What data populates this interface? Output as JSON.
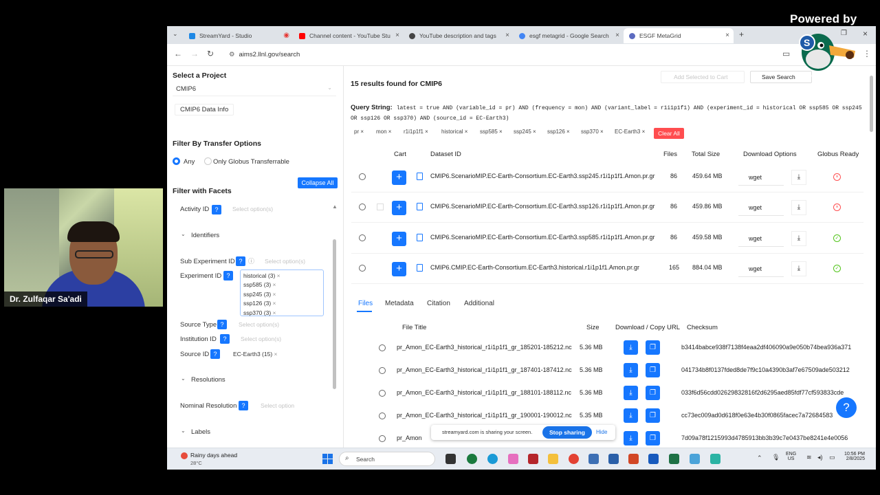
{
  "overlay": {
    "powered_by": "Powered by",
    "watermark": "StreamYard",
    "presenter_name": "Dr. Zulfaqar Sa'adi"
  },
  "browser": {
    "tabs": [
      {
        "label": "StreamYard - Studio",
        "color": "#1e88e5"
      },
      {
        "label": "Channel content - YouTube Stu",
        "color": "#ff0000"
      },
      {
        "label": "YouTube description and tags",
        "color": "#444444"
      },
      {
        "label": "esgf metagrid - Google Search",
        "color": "#4285f4"
      },
      {
        "label": "ESGF MetaGrid",
        "color": "#5c6bc0"
      }
    ],
    "url": "aims2.llnl.gov/search"
  },
  "left": {
    "select_project_title": "Select a Project",
    "project_value": "CMIP6",
    "data_info": "CMIP6 Data Info",
    "transfer_title": "Filter By Transfer Options",
    "radio_any": "Any",
    "radio_globus": "Only Globus Transferrable",
    "facets_title": "Filter with Facets",
    "collapse_all": "Collapse All",
    "activity_id": "Activity ID",
    "select_placeholder": "Select option(s)",
    "select_option": "Select option",
    "identifiers": "Identifiers",
    "sub_experiment_id": "Sub Experiment ID",
    "experiment_id": "Experiment ID",
    "experiment_chips": [
      "historical (3)",
      "ssp585 (3)",
      "ssp245 (3)",
      "ssp126 (3)",
      "ssp370 (3)"
    ],
    "source_type": "Source Type",
    "institution_id": "Institution ID",
    "source_id": "Source ID",
    "source_chip": "EC-Earth3 (15)",
    "resolutions": "Resolutions",
    "nominal_resolution": "Nominal Resolution",
    "labels": "Labels"
  },
  "right": {
    "add_selected": "Add Selected to Cart",
    "save_search": "Save Search",
    "results": "15 results found for CMIP6",
    "query_label": "Query String:",
    "query_text": "latest = true AND (variable_id = pr) AND (frequency = mon) AND (variant_label = r1i1p1f1) AND (experiment_id = historical OR ssp585 OR ssp245 OR ssp126 OR ssp370) AND (source_id = EC-Earth3)",
    "filter_chips": [
      "pr",
      "mon",
      "r1i1p1f1",
      "historical",
      "ssp585",
      "ssp245",
      "ssp126",
      "ssp370",
      "EC-Earth3"
    ],
    "clear_all": "Clear All",
    "columns": {
      "cart": "Cart",
      "dataset_id": "Dataset ID",
      "files": "Files",
      "total_size": "Total Size",
      "download": "Download Options",
      "globus": "Globus Ready"
    },
    "datasets": [
      {
        "id": "CMIP6.ScenarioMIP.EC-Earth-Consortium.EC-Earth3.ssp245.r1i1p1f1.Amon.pr.gr",
        "files": "86",
        "size": "459.64 MB",
        "dl": "wget",
        "globus": "no"
      },
      {
        "id": "CMIP6.ScenarioMIP.EC-Earth-Consortium.EC-Earth3.ssp126.r1i1p1f1.Amon.pr.gr",
        "files": "86",
        "size": "459.86 MB",
        "dl": "wget",
        "globus": "no"
      },
      {
        "id": "CMIP6.ScenarioMIP.EC-Earth-Consortium.EC-Earth3.ssp585.r1i1p1f1.Amon.pr.gr",
        "files": "86",
        "size": "459.58 MB",
        "dl": "wget",
        "globus": "yes"
      },
      {
        "id": "CMIP6.CMIP.EC-Earth-Consortium.EC-Earth3.historical.r1i1p1f1.Amon.pr.gr",
        "files": "165",
        "size": "884.04 MB",
        "dl": "wget",
        "globus": "yes"
      }
    ],
    "detail_tabs": [
      "Files",
      "Metadata",
      "Citation",
      "Additional"
    ],
    "file_columns": {
      "title": "File Title",
      "size": "Size",
      "download": "Download / Copy URL",
      "checksum": "Checksum"
    },
    "files": [
      {
        "title": "pr_Amon_EC-Earth3_historical_r1i1p1f1_gr_185201-185212.nc",
        "size": "5.36 MB",
        "checksum": "b3414babce938f7138f4eaa2df406090a9e050b74bea936a371"
      },
      {
        "title": "pr_Amon_EC-Earth3_historical_r1i1p1f1_gr_187401-187412.nc",
        "size": "5.36 MB",
        "checksum": "041734b8f0137fded8de7f9c10a4390b3af7e67509ade503212"
      },
      {
        "title": "pr_Amon_EC-Earth3_historical_r1i1p1f1_gr_188101-188112.nc",
        "size": "5.36 MB",
        "checksum": "033f6d56cdd02629832816f2d6295aed85fdf77cf593833cde"
      },
      {
        "title": "pr_Amon_EC-Earth3_historical_r1i1p1f1_gr_190001-190012.nc",
        "size": "5.35 MB",
        "checksum": "cc73ec009ad0d618f0e63e4b30f0865facec7a72684583"
      },
      {
        "title": "pr_Amon",
        "size": "",
        "checksum": "7d09a78f1215993d4785913bb3b39c7e0437be8241e4e0056"
      }
    ]
  },
  "share": {
    "text": "streamyard.com is sharing your screen.",
    "stop": "Stop sharing",
    "hide": "Hide"
  },
  "taskbar": {
    "weather_title": "Rainy days ahead",
    "weather_temp": "28°C",
    "search": "Search",
    "lang1": "ENG",
    "lang2": "US",
    "time": "10:56 PM",
    "date": "2/8/2025"
  },
  "colors": {
    "accent": "#1677ff",
    "danger": "#ff4d4f",
    "ok": "#52c41a"
  }
}
